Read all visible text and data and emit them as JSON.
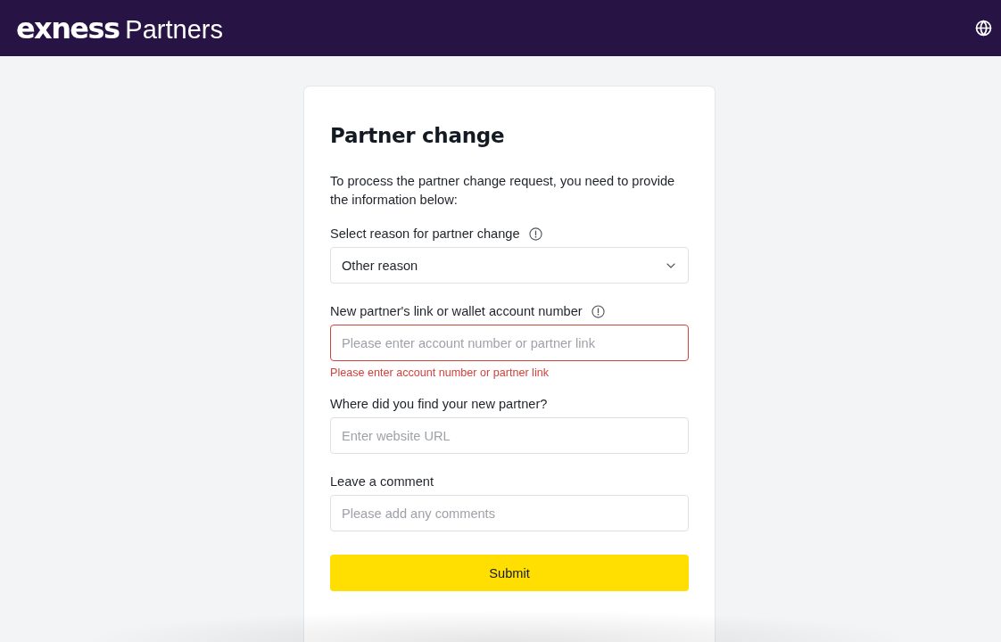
{
  "header": {
    "logo": "exness",
    "product": "Partners"
  },
  "form": {
    "title": "Partner change",
    "intro": "To process the partner change request, you need to provide the information below:",
    "fields": [
      {
        "kind": "select",
        "label": "Select reason for partner change",
        "info": true,
        "value": "Other reason"
      },
      {
        "kind": "text",
        "label": "New partner's link or wallet account number",
        "info": true,
        "placeholder": "Please enter account number or partner link",
        "error": "Please enter account number or partner link"
      },
      {
        "kind": "text",
        "label": "Where did you find your new partner?",
        "info": false,
        "placeholder": "Enter website URL"
      },
      {
        "kind": "text",
        "label": "Leave a comment",
        "info": false,
        "placeholder": "Please add any comments"
      }
    ],
    "submit": "Submit"
  }
}
